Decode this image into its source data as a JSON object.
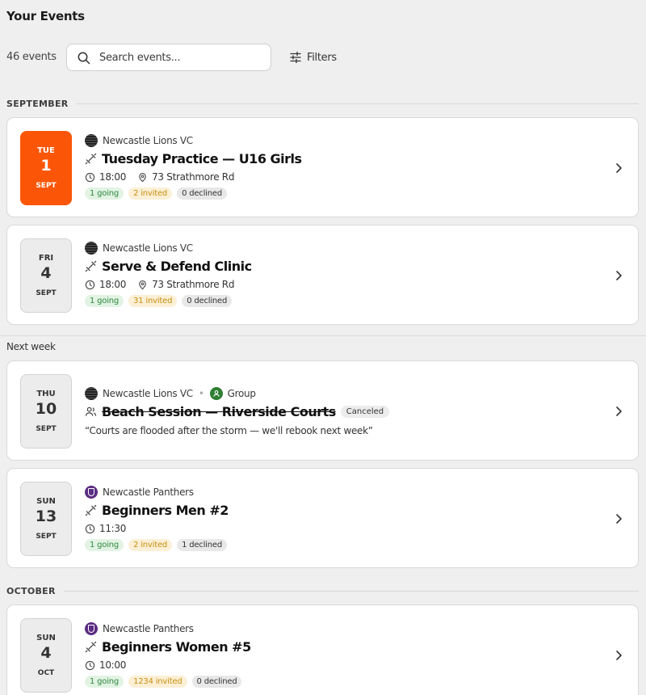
{
  "page": {
    "title": "Your Events"
  },
  "toolbar": {
    "count": "46 events",
    "search_placeholder": "Search events...",
    "filters_label": "Filters"
  },
  "sections": {
    "september": "SEPTEMBER",
    "next_week": "Next week",
    "october": "OCTOBER"
  },
  "colors": {
    "accent": "#fb5607",
    "going": "#2f8a3d",
    "invited": "#c88e0f",
    "group_icon": "#2e7d32",
    "panthers_logo": "#5b2d82"
  },
  "events": [
    {
      "dow": "TUE",
      "day": "1",
      "month": "SEPT",
      "highlighted": true,
      "club": "Newcastle Lions VC",
      "club_logo": "lions-logo",
      "type_icon": "dumbbell-icon",
      "title": "Tuesday Practice — U16 Girls",
      "time": "18:00",
      "location": "73 Strathmore Rd",
      "going": "1 going",
      "invited": "2 invited",
      "declined": "0 declined"
    },
    {
      "dow": "FRI",
      "day": "4",
      "month": "SEPT",
      "club": "Newcastle Lions VC",
      "club_logo": "lions-logo",
      "type_icon": "dumbbell-icon",
      "title": "Serve & Defend Clinic",
      "time": "18:00",
      "location": "73 Strathmore Rd",
      "going": "1 going",
      "invited": "31 invited",
      "declined": "0 declined"
    },
    {
      "dow": "THU",
      "day": "10",
      "month": "SEPT",
      "club": "Newcastle Lions VC",
      "club_logo": "lions-logo",
      "group_label": "Group",
      "type_icon": "people-icon",
      "title": "Beach Session — Riverside Courts",
      "status": "Canceled",
      "note": "“Courts are flooded after the storm — we'll rebook next week”"
    },
    {
      "dow": "SUN",
      "day": "13",
      "month": "SEPT",
      "club": "Newcastle Panthers",
      "club_logo": "panthers-logo",
      "type_icon": "dumbbell-icon",
      "title": "Beginners Men #2",
      "time": "11:30",
      "going": "1 going",
      "invited": "2 invited",
      "declined": "1 declined"
    },
    {
      "dow": "SUN",
      "day": "4",
      "month": "OCT",
      "club": "Newcastle Panthers",
      "club_logo": "panthers-logo",
      "type_icon": "dumbbell-icon",
      "title": "Beginners Women #5",
      "time": "10:00",
      "going": "1 going",
      "invited": "1234 invited",
      "declined": "0 declined"
    }
  ]
}
